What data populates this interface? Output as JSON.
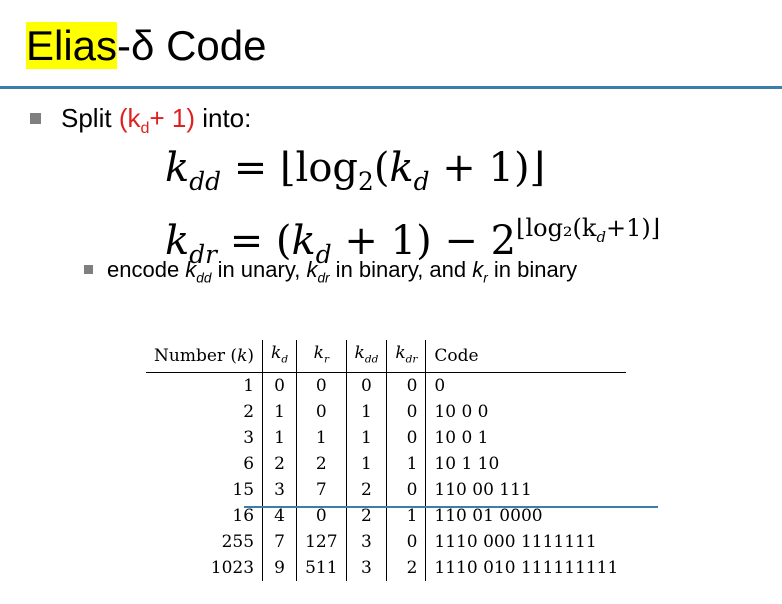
{
  "slide": {
    "title_highlight": "Elias",
    "title_rest": "-δ Code"
  },
  "bullet1": {
    "prefix": "Split ",
    "paren_open": "(k",
    "paren_sub": "d",
    "paren_close": "+ 1)",
    "suffix": " into:"
  },
  "equations": {
    "eq1": {
      "lhs_var": "k",
      "lhs_sub": "dd",
      "rhs": " = ⌊log",
      "rhs_sub": "2",
      "rhs_b": "(",
      "rhs_var": "k",
      "rhs_var_sub": "d",
      "rhs_end": " + 1)⌋"
    },
    "eq2": {
      "lhs_var": "k",
      "lhs_sub": "dr",
      "rhs": " = (",
      "rhs_var": "k",
      "rhs_var_sub": "d",
      "rhs_mid": " + 1) − 2",
      "exp": "⌊log₂(k",
      "exp_sub": "d",
      "exp_end": "+1)⌋"
    }
  },
  "bullet2": {
    "t1": "encode ",
    "v1": "k",
    "v1_sub": "dd",
    "t2": " in unary, ",
    "v2": "k",
    "v2_sub": "dr",
    "t3": " in binary, and ",
    "v3": "k",
    "v3_sub": "r",
    "t4": " in binary"
  },
  "table": {
    "headers": {
      "number": "Number (",
      "number_var": "k",
      "number_close": ")",
      "kd": "k",
      "kd_sub": "d",
      "kr": "k",
      "kr_sub": "r",
      "kdd": "k",
      "kdd_sub": "dd",
      "kdr": "k",
      "kdr_sub": "dr",
      "code": "Code"
    },
    "rows": [
      [
        "1",
        "0",
        "0",
        "0",
        "0",
        "0"
      ],
      [
        "2",
        "1",
        "0",
        "1",
        "0",
        "10 0 0"
      ],
      [
        "3",
        "1",
        "1",
        "1",
        "0",
        "10 0 1"
      ],
      [
        "6",
        "2",
        "2",
        "1",
        "1",
        "10 1 10"
      ],
      [
        "15",
        "3",
        "7",
        "2",
        "0",
        "110 00 111"
      ],
      [
        "16",
        "4",
        "0",
        "2",
        "1",
        "110 01 0000"
      ],
      [
        "255",
        "7",
        "127",
        "3",
        "0",
        "1110 000 1111111"
      ],
      [
        "1023",
        "9",
        "511",
        "3",
        "2",
        "1110 010 111111111"
      ]
    ]
  }
}
